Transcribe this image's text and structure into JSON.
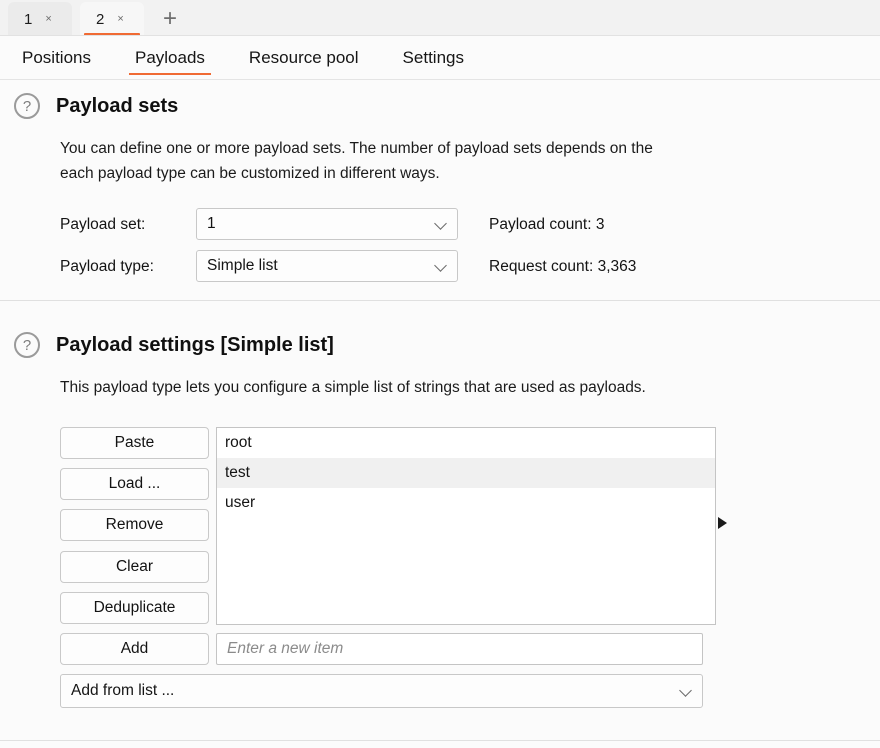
{
  "tabstrip": {
    "tabs": [
      {
        "label": "1",
        "close": "×",
        "active": false
      },
      {
        "label": "2",
        "close": "×",
        "active": true
      }
    ],
    "add_label": "+"
  },
  "nav": {
    "tabs": [
      {
        "label": "Positions",
        "active": false
      },
      {
        "label": "Payloads",
        "active": true
      },
      {
        "label": "Resource pool",
        "active": false
      },
      {
        "label": "Settings",
        "active": false
      }
    ]
  },
  "payload_sets": {
    "help_icon": "?",
    "title": "Payload sets",
    "description_line1": "You can define one or more payload sets. The number of payload sets depends on the",
    "description_line2": "each payload type can be customized in different ways.",
    "payload_set_label": "Payload set:",
    "payload_set_value": "1",
    "payload_type_label": "Payload type:",
    "payload_type_value": "Simple list",
    "payload_count": "Payload count: 3",
    "request_count": "Request count: 3,363"
  },
  "payload_settings": {
    "help_icon": "?",
    "title": "Payload settings [Simple list]",
    "description": "This payload type lets you configure a simple list of strings that are used as payloads.",
    "buttons": [
      {
        "label": "Paste"
      },
      {
        "label": "Load ..."
      },
      {
        "label": "Remove"
      },
      {
        "label": "Clear"
      },
      {
        "label": "Deduplicate"
      },
      {
        "label": "Add"
      }
    ],
    "list_items": [
      {
        "value": "root",
        "selected": false
      },
      {
        "value": "test",
        "selected": true
      },
      {
        "value": "user",
        "selected": false
      }
    ],
    "new_item_placeholder": "Enter a new item",
    "new_item_value": "",
    "add_from_list_label": "Add from list ..."
  },
  "colors": {
    "accent": "#f06a33",
    "background": "#fbfbfb",
    "selection": "#f0f0f0"
  }
}
